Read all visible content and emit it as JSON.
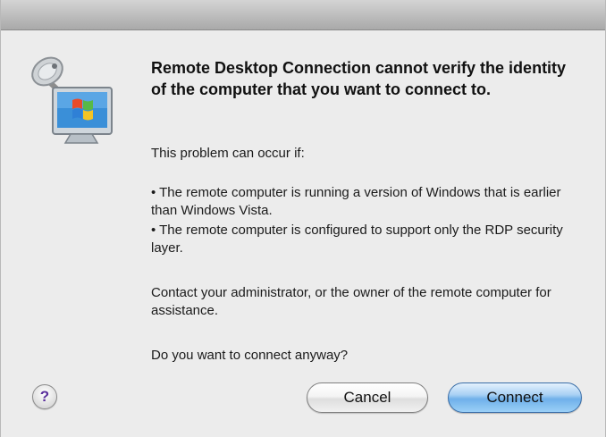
{
  "dialog": {
    "heading": "Remote Desktop Connection cannot verify the identity of the computer that you want to connect to.",
    "intro": "This problem can occur if:",
    "bullets": [
      "• The remote computer is running a version of Windows that is earlier than Windows Vista.",
      "• The remote computer is configured to support only the RDP security layer."
    ],
    "contact": "Contact your administrator, or the owner of the remote computer for assistance.",
    "question": "Do you want to connect anyway?"
  },
  "buttons": {
    "help_label": "?",
    "cancel_label": "Cancel",
    "connect_label": "Connect"
  },
  "icons": {
    "app_icon": "remote-desktop-icon",
    "help_icon": "help-icon"
  },
  "colors": {
    "window_bg": "#ececec",
    "default_button": "#6fb0ea",
    "help_glyph": "#5a2f9c"
  }
}
